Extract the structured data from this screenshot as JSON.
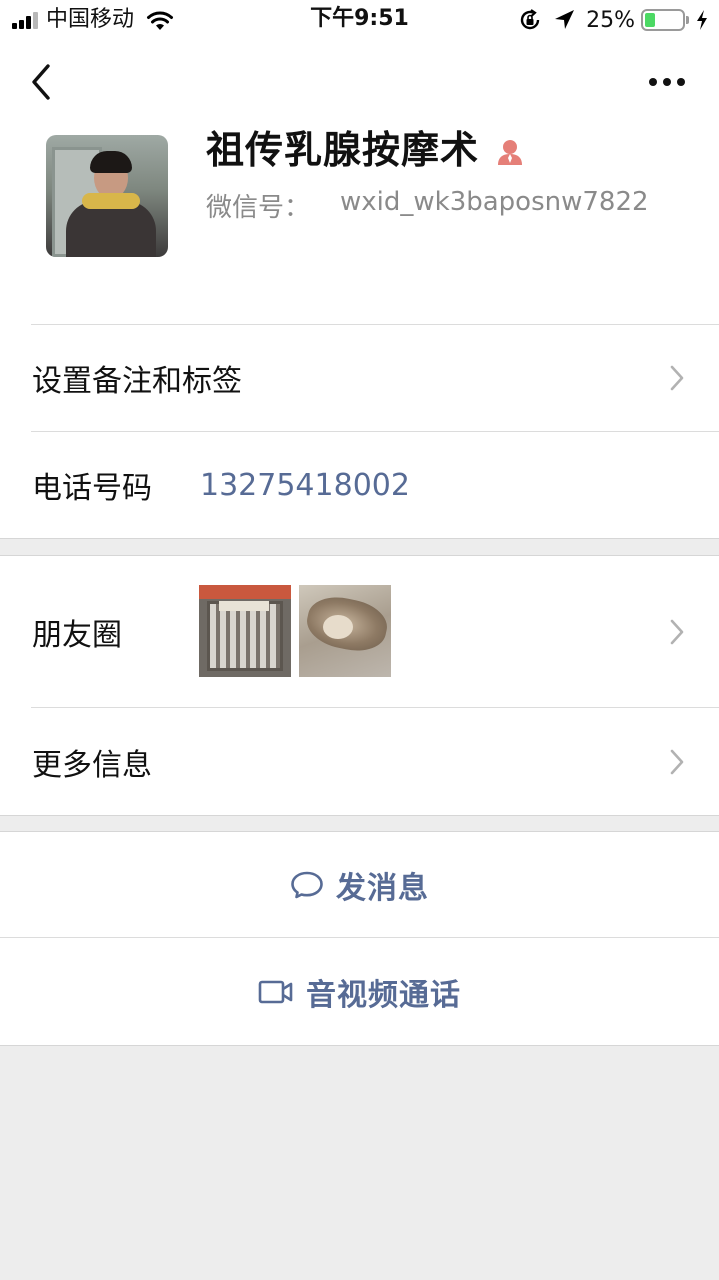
{
  "status_bar": {
    "carrier": "中国移动",
    "time": "下午9:51",
    "battery_percent": "25%",
    "battery_level": 0.25,
    "icons": [
      "signal-icon",
      "wifi-icon",
      "rotation-lock-icon",
      "location-icon",
      "battery-icon",
      "charging-icon"
    ]
  },
  "nav": {
    "back_icon": "chevron-left-icon",
    "more_icon": "more-dots-icon"
  },
  "profile": {
    "name": "祖传乳腺按摩术",
    "gender_icon": "female-icon",
    "wxid_label": "微信号：",
    "wxid_value": "wxid_wk3baposnw7822"
  },
  "rows": {
    "remark_label": "设置备注和标签",
    "phone_label": "电话号码",
    "phone_value": "13275418002",
    "moments_label": "朋友圈",
    "more_info_label": "更多信息"
  },
  "actions": {
    "message_label": "发消息",
    "message_icon": "chat-bubble-icon",
    "call_label": "音视频通话",
    "call_icon": "video-camera-icon"
  },
  "colors": {
    "link_blue": "#576b95",
    "background": "#ededed",
    "female_icon": "#e57f78",
    "battery_green": "#4cd964"
  }
}
